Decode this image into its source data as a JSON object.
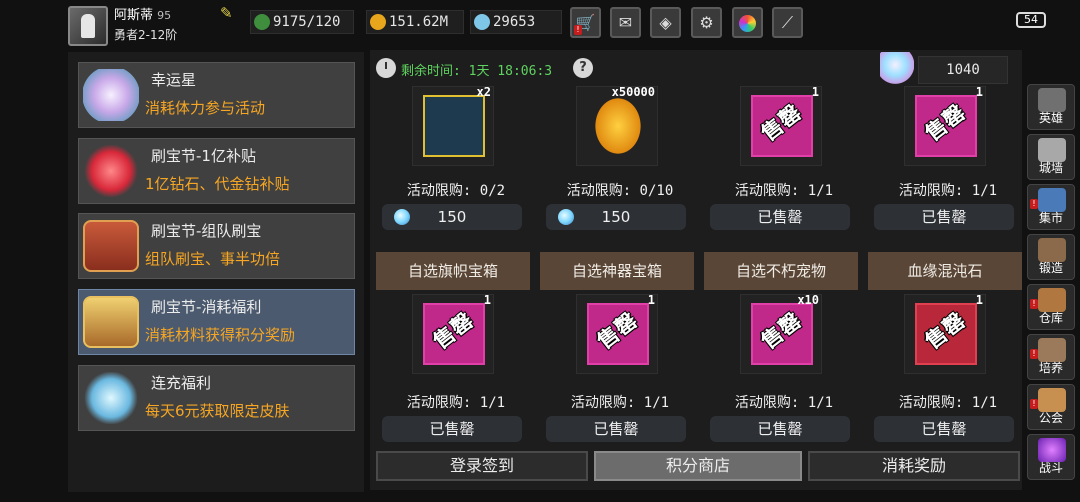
{
  "player": {
    "name": "阿斯蒂",
    "level_badge": "95",
    "rank": "勇者2-12阶"
  },
  "resources": {
    "stamina": "9175/120",
    "gold": "151.62M",
    "diamond": "29653"
  },
  "toolbar": {
    "icons": [
      "cart-icon",
      "mail-icon",
      "gamepad-icon",
      "gear-icon",
      "color-wheel-icon",
      "feather-icon"
    ]
  },
  "battery": "54",
  "events": [
    {
      "title": "幸运星",
      "subtitle": "消耗体力参与活动"
    },
    {
      "title": "刷宝节-1亿补贴",
      "subtitle": "1亿钻石、代金钻补贴"
    },
    {
      "title": "刷宝节-组队刷宝",
      "subtitle": "组队刷宝、事半功倍"
    },
    {
      "title": "刷宝节-消耗福利",
      "subtitle": "消耗材料获得积分奖励"
    },
    {
      "title": "连充福利",
      "subtitle": "每天6元获取限定皮肤"
    }
  ],
  "shop": {
    "timer_label": "剩余时间:",
    "timer_value": "1天  18:06:3",
    "points": "1040",
    "sold_stamp": "售罄",
    "row1": [
      {
        "qty": "x2",
        "limit": "活动限购: 0/2",
        "price": "150",
        "sold": false
      },
      {
        "qty": "x50000",
        "limit": "活动限购: 0/10",
        "price": "150",
        "sold": false
      },
      {
        "qty": "1",
        "limit": "活动限购: 1/1",
        "price": "已售罄",
        "sold": true
      },
      {
        "qty": "1",
        "limit": "活动限购: 1/1",
        "price": "已售罄",
        "sold": true
      }
    ],
    "row2": [
      {
        "header": "自选旗帜宝箱",
        "qty": "1",
        "limit": "活动限购: 1/1",
        "price": "已售罄"
      },
      {
        "header": "自选神器宝箱",
        "qty": "1",
        "limit": "活动限购: 1/1",
        "price": "已售罄"
      },
      {
        "header": "自选不朽宠物",
        "qty": "x10",
        "limit": "活动限购: 1/1",
        "price": "已售罄"
      },
      {
        "header": "血缘混沌石",
        "qty": "1",
        "limit": "活动限购: 1/1",
        "price": "已售罄"
      }
    ]
  },
  "tabs": [
    "登录签到",
    "积分商店",
    "消耗奖励"
  ],
  "sidebar": [
    "英雄",
    "城墙",
    "集市",
    "锻造",
    "仓库",
    "培养",
    "公会",
    "战斗"
  ],
  "colors": {
    "accent_orange": "#f6a623",
    "timer_green": "#5fd35f",
    "sold_magenta": "#c0288a",
    "header_brown": "#5a4636"
  }
}
